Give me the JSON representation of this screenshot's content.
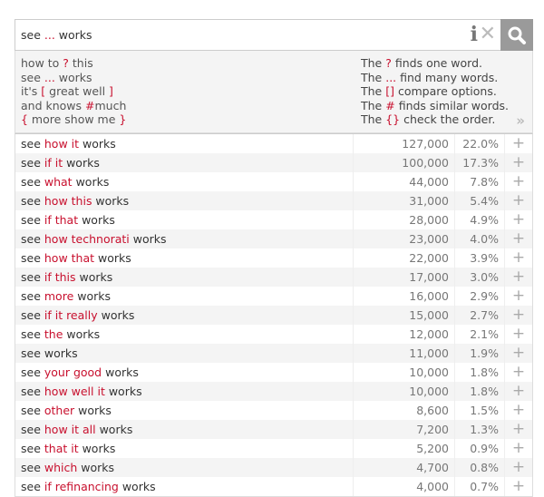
{
  "search": {
    "query_parts": [
      {
        "t": "see "
      },
      {
        "t": "...",
        "hl": true
      },
      {
        "t": " works"
      }
    ],
    "info_icon": "info-icon",
    "clear_icon": "close-icon",
    "search_icon": "search-icon"
  },
  "help": {
    "examples": [
      [
        {
          "t": "how to "
        },
        {
          "t": "?",
          "hl": true
        },
        {
          "t": " this"
        }
      ],
      [
        {
          "t": "see "
        },
        {
          "t": "...",
          "hl": true
        },
        {
          "t": " works"
        }
      ],
      [
        {
          "t": "it's "
        },
        {
          "t": "[",
          "hl": true
        },
        {
          "t": " great well "
        },
        {
          "t": "]",
          "hl": true
        }
      ],
      [
        {
          "t": "and knows "
        },
        {
          "t": "#",
          "hl": true
        },
        {
          "t": "much"
        }
      ],
      [
        {
          "t": "{",
          "hl": true
        },
        {
          "t": " more show me "
        },
        {
          "t": "}",
          "hl": true
        }
      ]
    ],
    "explanations": [
      [
        {
          "t": "The "
        },
        {
          "t": "?",
          "hl": true
        },
        {
          "t": " finds one word."
        }
      ],
      [
        {
          "t": "The "
        },
        {
          "t": "...",
          "hl": true
        },
        {
          "t": " find many words."
        }
      ],
      [
        {
          "t": "The "
        },
        {
          "t": "[]",
          "hl": true
        },
        {
          "t": " compare options."
        }
      ],
      [
        {
          "t": "The "
        },
        {
          "t": "#",
          "hl": true
        },
        {
          "t": " finds similar words."
        }
      ],
      [
        {
          "t": "The "
        },
        {
          "t": "{}",
          "hl": true
        },
        {
          "t": " check the order."
        }
      ]
    ],
    "more_label": "»"
  },
  "colors": {
    "highlight": "#c8102e"
  },
  "results": [
    {
      "parts": [
        {
          "t": "see "
        },
        {
          "t": "how it",
          "hl": true
        },
        {
          "t": " works"
        }
      ],
      "count": "127,000",
      "pct": "22.0%"
    },
    {
      "parts": [
        {
          "t": "see "
        },
        {
          "t": "if it",
          "hl": true
        },
        {
          "t": " works"
        }
      ],
      "count": "100,000",
      "pct": "17.3%"
    },
    {
      "parts": [
        {
          "t": "see "
        },
        {
          "t": "what",
          "hl": true
        },
        {
          "t": " works"
        }
      ],
      "count": "44,000",
      "pct": "7.8%"
    },
    {
      "parts": [
        {
          "t": "see "
        },
        {
          "t": "how this",
          "hl": true
        },
        {
          "t": " works"
        }
      ],
      "count": "31,000",
      "pct": "5.4%"
    },
    {
      "parts": [
        {
          "t": "see "
        },
        {
          "t": "if that",
          "hl": true
        },
        {
          "t": " works"
        }
      ],
      "count": "28,000",
      "pct": "4.9%"
    },
    {
      "parts": [
        {
          "t": "see "
        },
        {
          "t": "how technorati",
          "hl": true
        },
        {
          "t": " works"
        }
      ],
      "count": "23,000",
      "pct": "4.0%"
    },
    {
      "parts": [
        {
          "t": "see "
        },
        {
          "t": "how that",
          "hl": true
        },
        {
          "t": " works"
        }
      ],
      "count": "22,000",
      "pct": "3.9%"
    },
    {
      "parts": [
        {
          "t": "see "
        },
        {
          "t": "if this",
          "hl": true
        },
        {
          "t": " works"
        }
      ],
      "count": "17,000",
      "pct": "3.0%"
    },
    {
      "parts": [
        {
          "t": "see "
        },
        {
          "t": "more",
          "hl": true
        },
        {
          "t": " works"
        }
      ],
      "count": "16,000",
      "pct": "2.9%"
    },
    {
      "parts": [
        {
          "t": "see "
        },
        {
          "t": "if it really",
          "hl": true
        },
        {
          "t": " works"
        }
      ],
      "count": "15,000",
      "pct": "2.7%"
    },
    {
      "parts": [
        {
          "t": "see "
        },
        {
          "t": "the",
          "hl": true
        },
        {
          "t": " works"
        }
      ],
      "count": "12,000",
      "pct": "2.1%"
    },
    {
      "parts": [
        {
          "t": "see works"
        }
      ],
      "count": "11,000",
      "pct": "1.9%"
    },
    {
      "parts": [
        {
          "t": "see "
        },
        {
          "t": "your good",
          "hl": true
        },
        {
          "t": " works"
        }
      ],
      "count": "10,000",
      "pct": "1.8%"
    },
    {
      "parts": [
        {
          "t": "see "
        },
        {
          "t": "how well it",
          "hl": true
        },
        {
          "t": " works"
        }
      ],
      "count": "10,000",
      "pct": "1.8%"
    },
    {
      "parts": [
        {
          "t": "see "
        },
        {
          "t": "other",
          "hl": true
        },
        {
          "t": " works"
        }
      ],
      "count": "8,600",
      "pct": "1.5%"
    },
    {
      "parts": [
        {
          "t": "see "
        },
        {
          "t": "how it all",
          "hl": true
        },
        {
          "t": " works"
        }
      ],
      "count": "7,200",
      "pct": "1.3%"
    },
    {
      "parts": [
        {
          "t": "see "
        },
        {
          "t": "that it",
          "hl": true
        },
        {
          "t": " works"
        }
      ],
      "count": "5,200",
      "pct": "0.9%"
    },
    {
      "parts": [
        {
          "t": "see "
        },
        {
          "t": "which",
          "hl": true
        },
        {
          "t": " works"
        }
      ],
      "count": "4,700",
      "pct": "0.8%"
    },
    {
      "parts": [
        {
          "t": "see "
        },
        {
          "t": "if refinancing",
          "hl": true
        },
        {
          "t": " works"
        }
      ],
      "count": "4,000",
      "pct": "0.7%"
    }
  ],
  "add_label": "+"
}
